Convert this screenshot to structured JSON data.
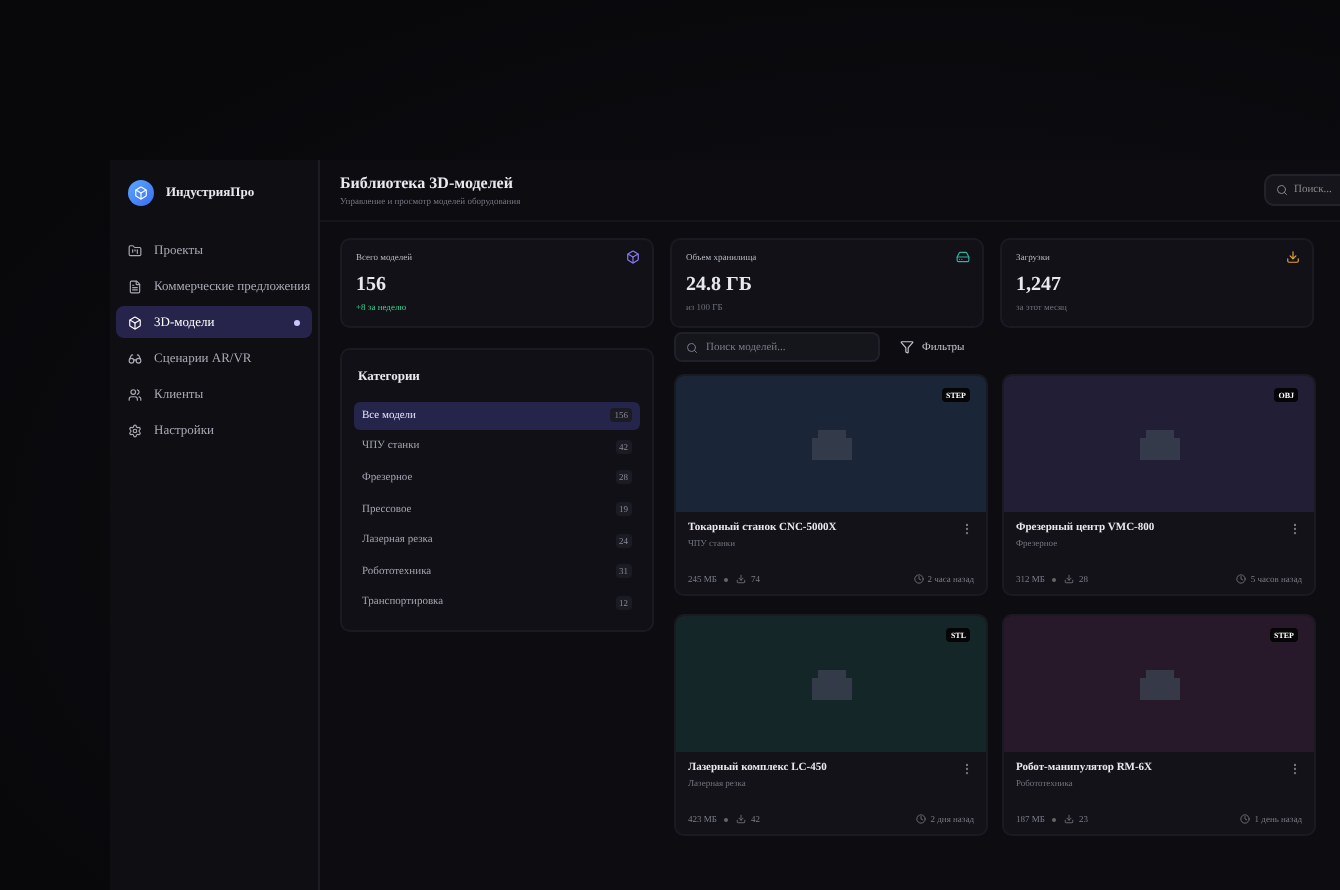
{
  "brand": {
    "name": "ИндустрияПро"
  },
  "nav": [
    {
      "kind": "projects",
      "label": "Проекты",
      "selected": false
    },
    {
      "kind": "offers",
      "label": "Коммерческие предложения",
      "selected": false
    },
    {
      "kind": "models",
      "label": "3D-модели",
      "selected": true
    },
    {
      "kind": "vr",
      "label": "Сценарии AR/VR",
      "selected": false
    },
    {
      "kind": "clients",
      "label": "Клиенты",
      "selected": false
    },
    {
      "kind": "settings",
      "label": "Настройки",
      "selected": false
    }
  ],
  "header": {
    "title": "Библиотека 3D-моделей",
    "subtitle": "Управление и просмотр моделей оборудования",
    "search": {
      "placeholder": "Поиск..."
    }
  },
  "stats": [
    {
      "kind": "models",
      "label": "Всего моделей",
      "value": "156",
      "note": "+8 за неделю",
      "positive": true
    },
    {
      "kind": "storage",
      "label": "Объем хранилища",
      "value": "24.8 ГБ",
      "note": "из 100 ГБ",
      "positive": false
    },
    {
      "kind": "downloads",
      "label": "Загрузки",
      "value": "1,247",
      "note": "за этот месяц",
      "positive": false
    }
  ],
  "categories": {
    "title": "Категории",
    "items": [
      {
        "label": "Все модели",
        "count": "156",
        "selected": true
      },
      {
        "label": "ЧПУ станки",
        "count": "42",
        "selected": false
      },
      {
        "label": "Фрезерное",
        "count": "28",
        "selected": false
      },
      {
        "label": "Прессовое",
        "count": "19",
        "selected": false
      },
      {
        "label": "Лазерная резка",
        "count": "24",
        "selected": false
      },
      {
        "label": "Робототехника",
        "count": "31",
        "selected": false
      },
      {
        "label": "Транспортировка",
        "count": "12",
        "selected": false
      }
    ]
  },
  "toolbar": {
    "search": {
      "placeholder": "Поиск моделей..."
    },
    "filters": "Фильтры"
  },
  "models": [
    {
      "title": "Токарный станок CNC-5000X",
      "category": "ЧПУ станки",
      "format": "STEP",
      "size": "245 МБ",
      "downloads": "74",
      "time": "2 часа назад",
      "color": "#1a2638"
    },
    {
      "title": "Фрезерный центр VMC-800",
      "category": "Фрезерное",
      "format": "OBJ",
      "size": "312 МБ",
      "downloads": "28",
      "time": "5 часов назад",
      "color": "#221e36"
    },
    {
      "title": "Лазерный комплекс LC-450",
      "category": "Лазерная резка",
      "format": "STL",
      "size": "423 МБ",
      "downloads": "42",
      "time": "2 дня назад",
      "color": "#142627"
    },
    {
      "title": "Робот-манипулятор RM-6X",
      "category": "Робототехника",
      "format": "STEP",
      "size": "187 МБ",
      "downloads": "23",
      "time": "1 день назад",
      "color": "#28192a"
    }
  ]
}
